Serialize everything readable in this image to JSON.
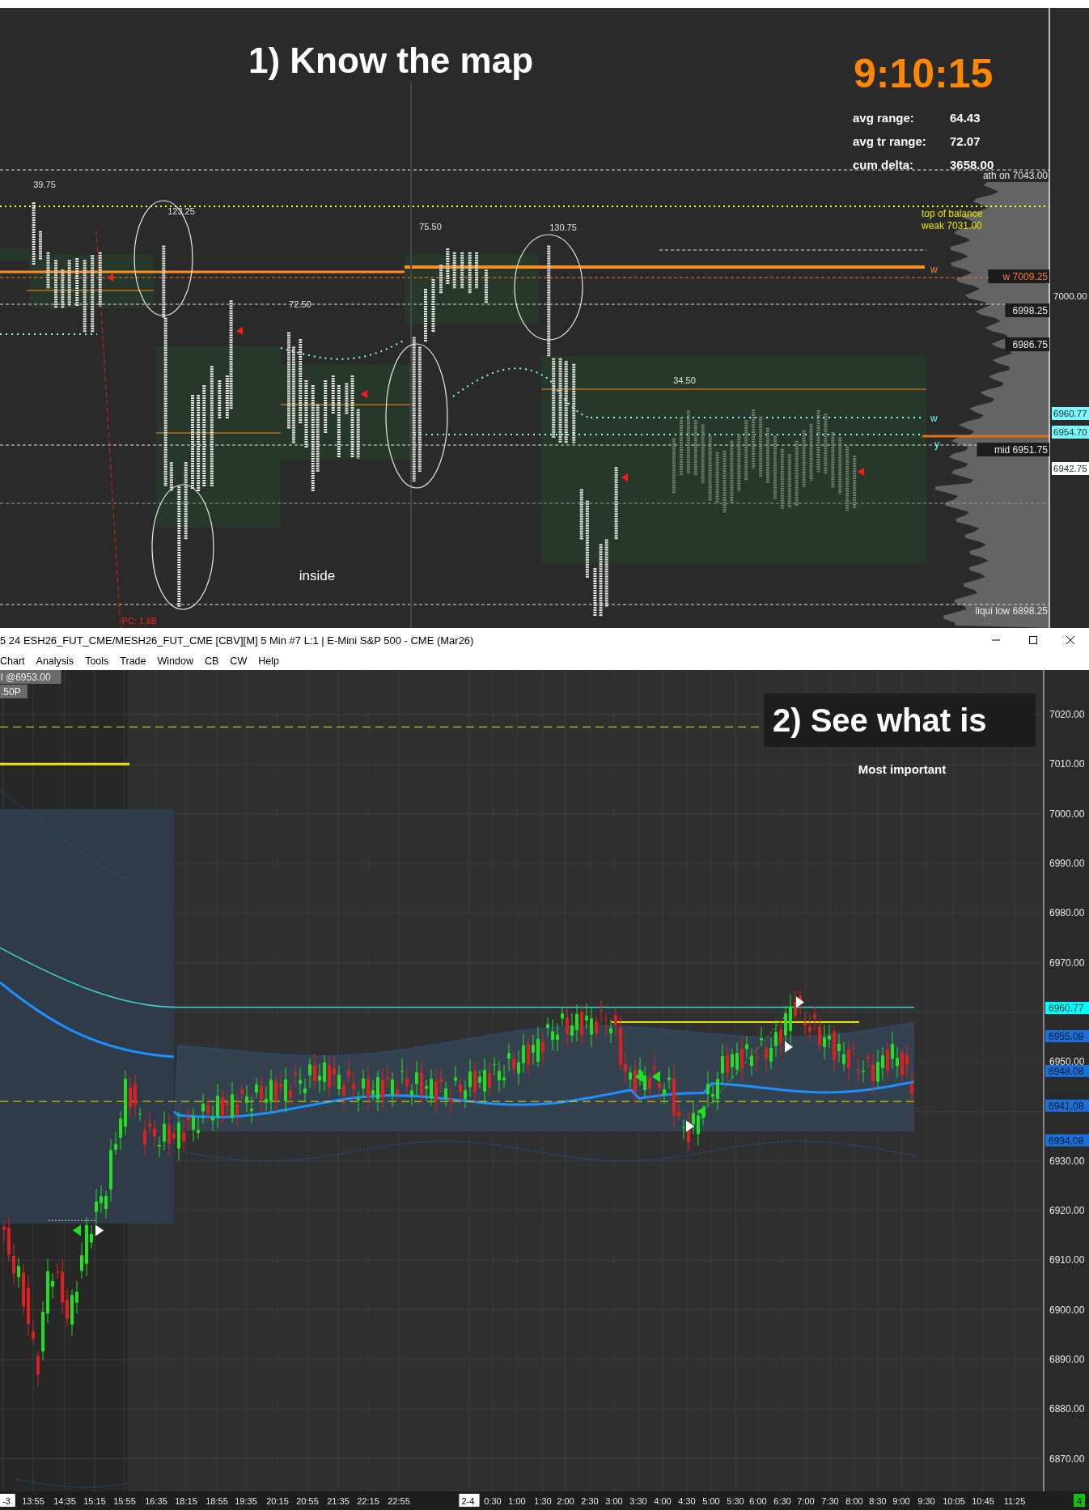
{
  "top_chart": {
    "title": "1)  Know the map",
    "clock": "9:10:15",
    "stats": [
      {
        "label": "avg range:",
        "value": "64.43"
      },
      {
        "label": "avg tr range:",
        "value": "72.07"
      },
      {
        "label": "cum delta:",
        "value": "3658.00"
      }
    ],
    "level_labels": [
      {
        "text": "ath on  7043.00",
        "kind": "plain"
      },
      {
        "text": "top of balance",
        "kind": "yellow"
      },
      {
        "text": "weak  7031.00",
        "kind": "yellow"
      },
      {
        "text": "w  7009.25",
        "kind": "orange"
      },
      {
        "text": "6998.25",
        "kind": "boxed"
      },
      {
        "text": "6986.75",
        "kind": "boxed"
      },
      {
        "text": "mid  6951.75",
        "kind": "boxed"
      },
      {
        "text": "liqui low  6898.25",
        "kind": "plain"
      }
    ],
    "line_marks": [
      {
        "text": "w",
        "kind": "orange"
      },
      {
        "text": "w",
        "kind": "cyan"
      },
      {
        "text": "y",
        "kind": "cyan"
      }
    ],
    "axis_tags": [
      {
        "text": "7000.00",
        "kind": "axis"
      },
      {
        "text": "6960.77",
        "kind": "cyan"
      },
      {
        "text": "6954.70",
        "kind": "cyan"
      },
      {
        "text": "6942.75",
        "kind": "white"
      }
    ],
    "annotations": [
      {
        "text": "39.75",
        "kind": "number"
      },
      {
        "text": "123.25",
        "kind": "number"
      },
      {
        "text": "75.50",
        "kind": "number"
      },
      {
        "text": "130.75",
        "kind": "number"
      },
      {
        "text": "72.50",
        "kind": "number"
      },
      {
        "text": "34.50",
        "kind": "number"
      },
      {
        "text": "inside",
        "kind": "note"
      },
      {
        "text": "PC: 1.88",
        "kind": "alert"
      }
    ]
  },
  "bottom_window": {
    "title": "5 24 ESH26_FUT_CME/MESH26_FUT_CME [CBV][M]  5 Min  #7 L:1 | E-Mini S&P 500 - CME (Mar26)",
    "menu": [
      "Chart",
      "Analysis",
      "Tools",
      "Trade",
      "Window",
      "CB",
      "CW",
      "Help"
    ],
    "info": [
      "l @6953.00",
      ".50P"
    ],
    "overlay_title": "2)  See what is",
    "subtitle": "Most important",
    "price_axis": [
      "7020.00",
      "7010.00",
      "7000.00",
      "6990.00",
      "6980.00",
      "6970.00",
      "6950.00",
      "6930.00",
      "6920.00",
      "6910.00",
      "6900.00",
      "6890.00",
      "6880.00",
      "6870.00"
    ],
    "price_tags": [
      {
        "text": "6960.77",
        "kind": "cyan"
      },
      {
        "text": "6955.08",
        "kind": "blue"
      },
      {
        "text": "6948.08",
        "kind": "blue"
      },
      {
        "text": "6941.08",
        "kind": "blue"
      },
      {
        "text": "6934.08",
        "kind": "blue"
      }
    ],
    "time_axis": [
      {
        "label": "-3",
        "kind": "box"
      },
      {
        "label": "13:55",
        "kind": "plain"
      },
      {
        "label": "14:35",
        "kind": "plain"
      },
      {
        "label": "15:15",
        "kind": "plain"
      },
      {
        "label": "15:55",
        "kind": "plain"
      },
      {
        "label": "16:35",
        "kind": "plain"
      },
      {
        "label": "18:15",
        "kind": "plain"
      },
      {
        "label": "18:55",
        "kind": "plain"
      },
      {
        "label": "19:35",
        "kind": "plain"
      },
      {
        "label": "20:15",
        "kind": "plain"
      },
      {
        "label": "20:55",
        "kind": "plain"
      },
      {
        "label": "21:35",
        "kind": "plain"
      },
      {
        "label": "22:15",
        "kind": "plain"
      },
      {
        "label": "22:55",
        "kind": "plain"
      },
      {
        "label": "2-4",
        "kind": "box"
      },
      {
        "label": "0:30",
        "kind": "plain"
      },
      {
        "label": "1:00",
        "kind": "plain"
      },
      {
        "label": "1:30",
        "kind": "plain"
      },
      {
        "label": "2:00",
        "kind": "plain"
      },
      {
        "label": "2:30",
        "kind": "plain"
      },
      {
        "label": "3:00",
        "kind": "plain"
      },
      {
        "label": "3:30",
        "kind": "plain"
      },
      {
        "label": "4:00",
        "kind": "plain"
      },
      {
        "label": "4:30",
        "kind": "plain"
      },
      {
        "label": "5:00",
        "kind": "plain"
      },
      {
        "label": "5:30",
        "kind": "plain"
      },
      {
        "label": "6:00",
        "kind": "plain"
      },
      {
        "label": "6:30",
        "kind": "plain"
      },
      {
        "label": "7:00",
        "kind": "plain"
      },
      {
        "label": "7:30",
        "kind": "plain"
      },
      {
        "label": "8:00",
        "kind": "plain"
      },
      {
        "label": "8:30",
        "kind": "plain"
      },
      {
        "label": "9:00",
        "kind": "plain"
      },
      {
        "label": "9:30",
        "kind": "plain"
      },
      {
        "label": "10:05",
        "kind": "plain"
      },
      {
        "label": "10:45",
        "kind": "plain"
      },
      {
        "label": "11:25",
        "kind": "plain"
      }
    ],
    "badge": "4"
  }
}
